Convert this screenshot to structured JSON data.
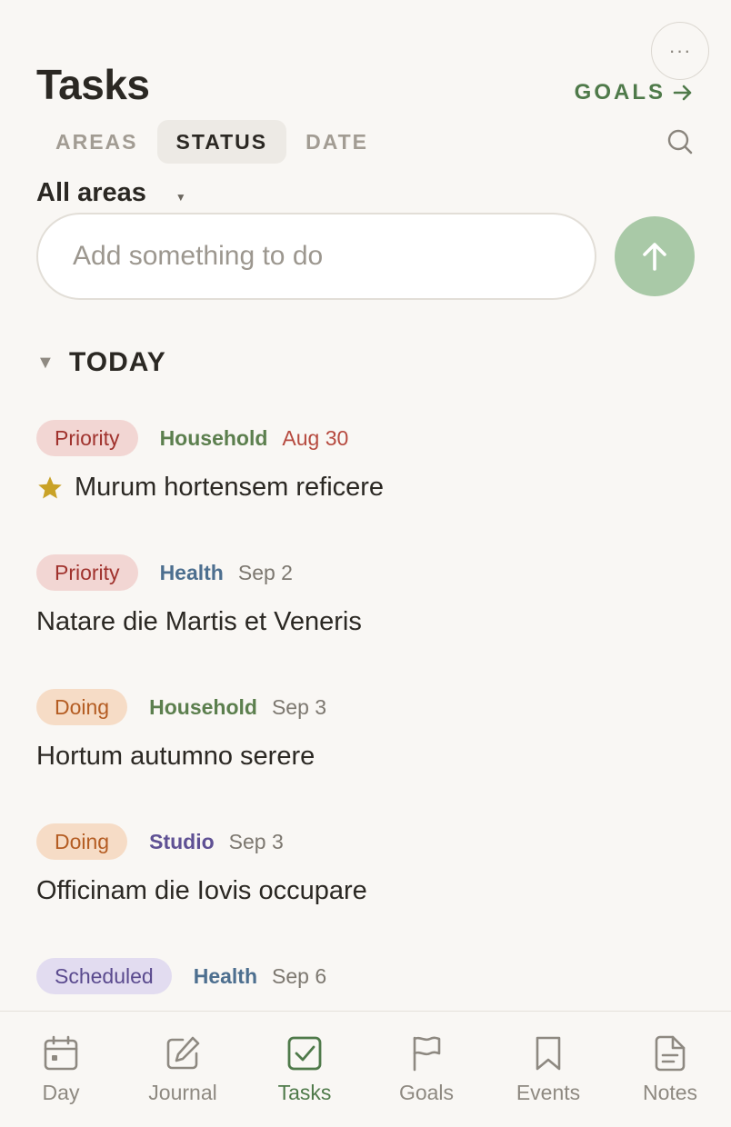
{
  "header": {
    "title": "Tasks",
    "goals_link": "GOALS",
    "more_icon": "more-horizontal-icon"
  },
  "tabs": [
    {
      "label": "AREAS",
      "active": false
    },
    {
      "label": "STATUS",
      "active": true
    },
    {
      "label": "DATE",
      "active": false
    }
  ],
  "filter": {
    "selected_area": "All areas"
  },
  "composer": {
    "placeholder": "Add something to do",
    "value": ""
  },
  "section": {
    "label": "TODAY"
  },
  "tasks": [
    {
      "status": "Priority",
      "area": "Household",
      "date": "Aug 30",
      "title": "Murum hortensem reficere",
      "starred": true
    },
    {
      "status": "Priority",
      "area": "Health",
      "date": "Sep 2",
      "title": "Natare die Martis et Veneris",
      "starred": false
    },
    {
      "status": "Doing",
      "area": "Household",
      "date": "Sep 3",
      "title": "Hortum autumno serere",
      "starred": false
    },
    {
      "status": "Doing",
      "area": "Studio",
      "date": "Sep 3",
      "title": "Officinam die Iovis occupare",
      "starred": false
    },
    {
      "status": "Scheduled",
      "area": "Health",
      "date": "Sep 6",
      "title": "",
      "starred": false
    }
  ],
  "nav": [
    {
      "label": "Day",
      "icon": "calendar-icon",
      "active": false
    },
    {
      "label": "Journal",
      "icon": "edit-icon",
      "active": false
    },
    {
      "label": "Tasks",
      "icon": "checkbox-icon",
      "active": true
    },
    {
      "label": "Goals",
      "icon": "flag-icon",
      "active": false
    },
    {
      "label": "Events",
      "icon": "bookmark-icon",
      "active": false
    },
    {
      "label": "Notes",
      "icon": "note-icon",
      "active": false
    }
  ],
  "colors": {
    "accent": "#4f7a4a",
    "overdue": "#b64a3f",
    "area_household": "#5c7f4e",
    "area_health": "#4d6f8f",
    "area_studio": "#5f5194"
  }
}
